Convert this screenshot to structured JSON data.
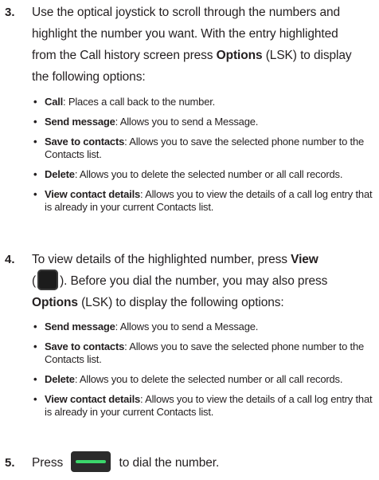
{
  "step3": {
    "number": "3.",
    "line1": "Use the optical joystick to scroll through the numbers and",
    "line2": "highlight the number you want. With the entry highlighted",
    "line3_a": "from the Call history screen press ",
    "line3_bold": "Options",
    "line3_b": " (LSK) to display",
    "line4": "the following options:",
    "bullets": [
      {
        "term": "Call",
        "desc": ": Places a call back to the number."
      },
      {
        "term": "Send message",
        "desc": ": Allows you to send a Message."
      },
      {
        "term": "Save to contacts",
        "desc": ": Allows you to save the selected phone number to the Contacts list."
      },
      {
        "term": "Delete",
        "desc": ": Allows you to delete the selected number or all call records."
      },
      {
        "term": "View contact details",
        "desc": ": Allows you to view the details of a call log entry that is already in your current Contacts list."
      }
    ]
  },
  "step4": {
    "number": "4.",
    "line1_a": "To view details of the highlighted number, press ",
    "line1_bold": "View",
    "line2_a": "(",
    "line2_b": "). Before you dial the number, you may also press",
    "line3_bold": "Options",
    "line3_b": " (LSK) to display the following options:",
    "bullets": [
      {
        "term": "Send message",
        "desc": ": Allows you to send a Message."
      },
      {
        "term": "Save to contacts",
        "desc": ": Allows you to save the selected phone number to the Contacts list."
      },
      {
        "term": "Delete",
        "desc": ": Allows you to delete the selected number or all call records."
      },
      {
        "term": "View contact details",
        "desc": ": Allows you to view the details of a call log entry that is already in your current Contacts list."
      }
    ]
  },
  "step5": {
    "number": "5.",
    "text_a": "Press ",
    "text_b": " to dial the number."
  },
  "icons": {
    "view_key": "view-key-icon",
    "send_key": "send-key-icon",
    "send_key_accent": "#3bd66b"
  }
}
